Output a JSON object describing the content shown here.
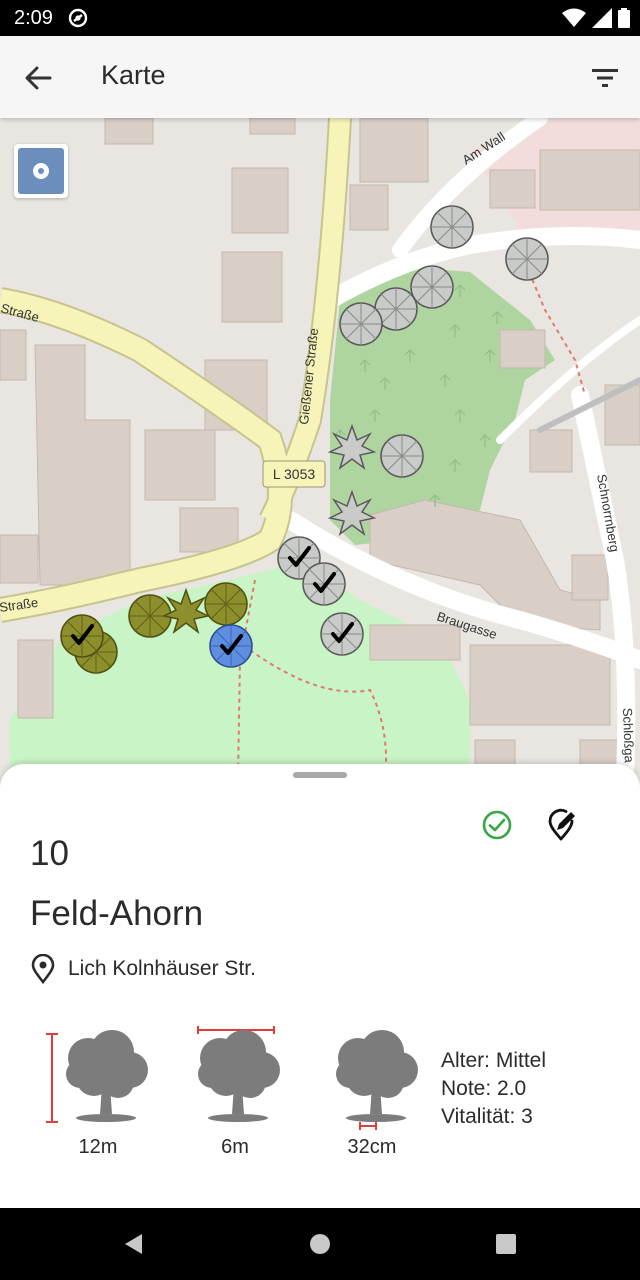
{
  "status_bar": {
    "time": "2:09"
  },
  "app_bar": {
    "title": "Karte",
    "back_icon": "arrow-back-icon",
    "filter_icon": "filter-icon"
  },
  "map": {
    "street_labels": {
      "strasse_top": "Straße",
      "giessener": "Gießener Straße",
      "am_wall": "Am Wall",
      "l3053": "L 3053",
      "strasse_bottom": "Straße",
      "braugasse": "Braugasse",
      "schnorrnberg": "Schnorrnberg",
      "schlossga": "Schloßga"
    },
    "colors": {
      "tree_gray": "#c9cbc8",
      "tree_olive": "#8d8f2c",
      "tree_selected": "#5f8ee0",
      "park": "#aed4a0",
      "meadow": "#c9f4c6",
      "primary_road": "#f6f4b8"
    }
  },
  "detail": {
    "number": "10",
    "species": "Feld-Ahorn",
    "location": "Lich Kolnhäuser Str.",
    "height": "12m",
    "crown": "6m",
    "trunk": "32cm",
    "age": "Alter: Mittel",
    "grade": "Note: 2.0",
    "vitality": "Vitalität: 3",
    "status_color": "#3aa544"
  }
}
